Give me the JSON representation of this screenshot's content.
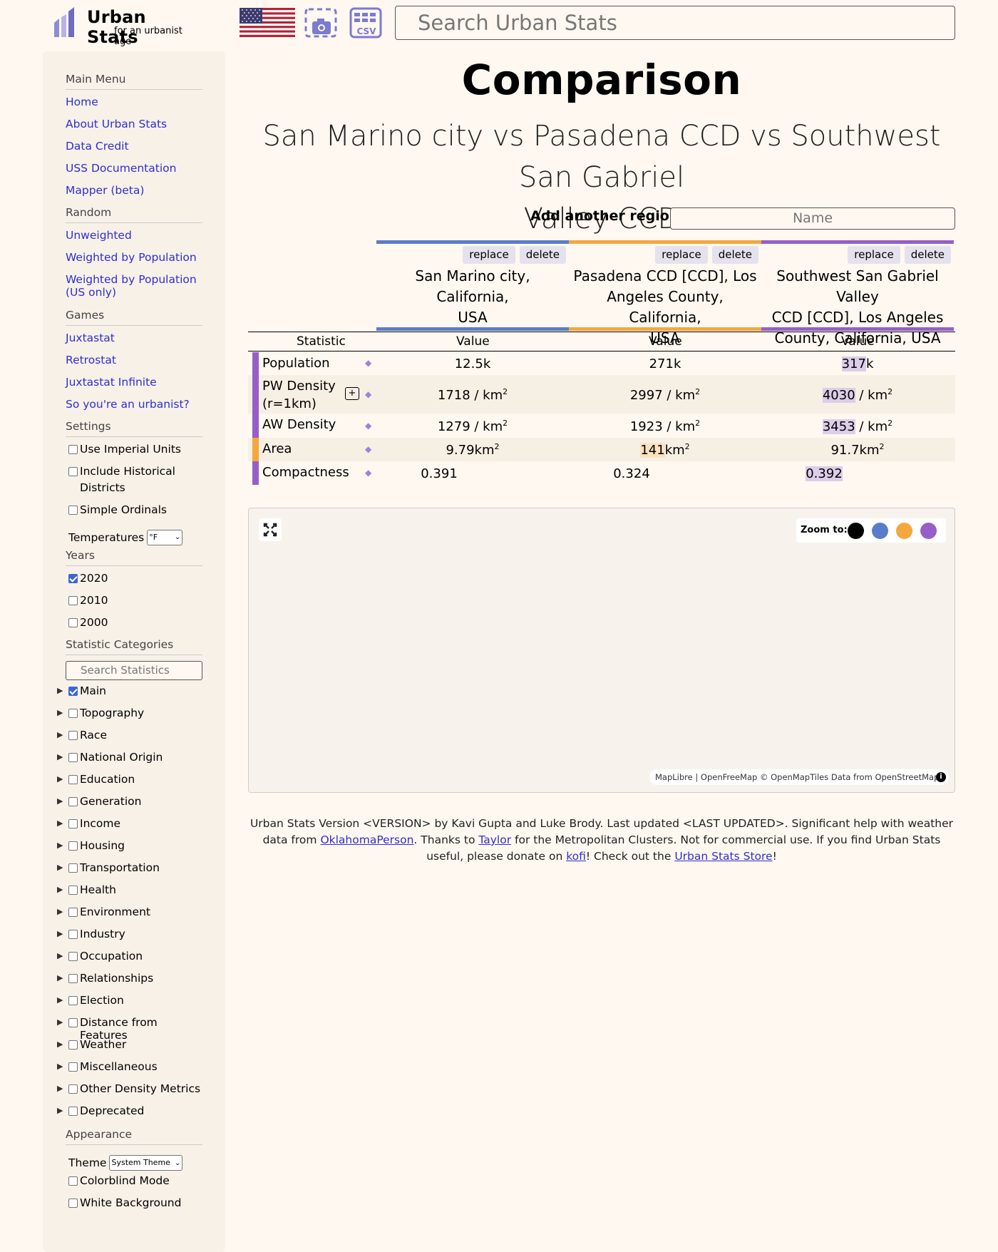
{
  "header": {
    "logo_title": "Urban Stats",
    "logo_subtitle": "for an urbanist age",
    "flag_icon": "us-flag-icon",
    "camera_icon": "screenshot-icon",
    "csv_icon": "csv-icon",
    "search_placeholder": "Search Urban Stats"
  },
  "sidebar": {
    "main_menu": {
      "heading": "Main Menu",
      "links": [
        "Home",
        "About Urban Stats",
        "Data Credit",
        "USS Documentation",
        "Mapper (beta)"
      ]
    },
    "random": {
      "heading": "Random",
      "links": [
        "Unweighted",
        "Weighted by Population",
        "Weighted by Population (US only)"
      ]
    },
    "games": {
      "heading": "Games",
      "links": [
        "Juxtastat",
        "Retrostat",
        "Juxtastat Infinite",
        "So you're an urbanist?"
      ]
    },
    "settings": {
      "heading": "Settings",
      "options": [
        {
          "label": "Use Imperial Units",
          "checked": false
        },
        {
          "label": "Include Historical Districts",
          "checked": false
        },
        {
          "label": "Simple Ordinals",
          "checked": false
        }
      ],
      "temperatures_label": "Temperatures",
      "temperatures_value": "°F"
    },
    "years": {
      "heading": "Years",
      "options": [
        {
          "label": "2020",
          "checked": true
        },
        {
          "label": "2010",
          "checked": false
        },
        {
          "label": "2000",
          "checked": false
        }
      ]
    },
    "statistic_categories": {
      "heading": "Statistic Categories",
      "search_placeholder": "Search Statistics",
      "items": [
        {
          "label": "Main",
          "checked": true
        },
        {
          "label": "Topography",
          "checked": false
        },
        {
          "label": "Race",
          "checked": false
        },
        {
          "label": "National Origin",
          "checked": false
        },
        {
          "label": "Education",
          "checked": false
        },
        {
          "label": "Generation",
          "checked": false
        },
        {
          "label": "Income",
          "checked": false
        },
        {
          "label": "Housing",
          "checked": false
        },
        {
          "label": "Transportation",
          "checked": false
        },
        {
          "label": "Health",
          "checked": false
        },
        {
          "label": "Environment",
          "checked": false
        },
        {
          "label": "Industry",
          "checked": false
        },
        {
          "label": "Occupation",
          "checked": false
        },
        {
          "label": "Relationships",
          "checked": false
        },
        {
          "label": "Election",
          "checked": false
        },
        {
          "label": "Distance from Features",
          "checked": false
        },
        {
          "label": "Weather",
          "checked": false
        },
        {
          "label": "Miscellaneous",
          "checked": false
        },
        {
          "label": "Other Density Metrics",
          "checked": false
        },
        {
          "label": "Deprecated",
          "checked": false
        }
      ]
    },
    "appearance": {
      "heading": "Appearance",
      "theme_label": "Theme",
      "theme_value": "System Theme",
      "options": [
        {
          "label": "Colorblind Mode",
          "checked": false
        },
        {
          "label": "White Background",
          "checked": false
        }
      ]
    }
  },
  "main": {
    "title": "Comparison",
    "subtitle_line1": "San Marino city vs Pasadena CCD vs Southwest San Gabriel",
    "subtitle_line2": "Valley CCD",
    "add_region_label": "Add another region:",
    "add_region_placeholder": "Name",
    "replace_label": "replace",
    "delete_label": "delete",
    "regions": [
      {
        "name": "San Marino city, California, USA",
        "color": "#5a7dc9"
      },
      {
        "name": "Pasadena CCD [CCD], Los Angeles County, California, USA",
        "color": "#f4a73f"
      },
      {
        "name": "Southwest San Gabriel Valley CCD [CCD], Los Angeles County, California, USA",
        "color": "#975ec8"
      }
    ],
    "table": {
      "headers": {
        "statistic": "Statistic",
        "value": "Value"
      },
      "rows": [
        {
          "statistic": "Population",
          "stripe": "#975ec8",
          "values": [
            {
              "num": "12.5",
              "unit": "k",
              "sup": ""
            },
            {
              "num": "271",
              "unit": "k",
              "sup": ""
            },
            {
              "num": "317",
              "unit": "k",
              "sup": ""
            }
          ]
        },
        {
          "statistic_l1": "PW Density",
          "statistic_l2": "(r=1km)",
          "stripe": "#975ec8",
          "values": [
            {
              "num": "1718",
              "unit": " / km",
              "sup": "2"
            },
            {
              "num": "2997",
              "unit": " / km",
              "sup": "2"
            },
            {
              "num": "4030",
              "unit": " / km",
              "sup": "2"
            }
          ]
        },
        {
          "statistic": "AW Density",
          "stripe": "#975ec8",
          "values": [
            {
              "num": "1279",
              "unit": " / km",
              "sup": "2"
            },
            {
              "num": "1923",
              "unit": " / km",
              "sup": "2"
            },
            {
              "num": "3453",
              "unit": " / km",
              "sup": "2"
            }
          ]
        },
        {
          "statistic": "Area",
          "stripe": "#f4a73f",
          "values": [
            {
              "num": "9.79",
              "unit": "km",
              "sup": "2"
            },
            {
              "num": "141",
              "unit": "km",
              "sup": "2"
            },
            {
              "num": "91.7",
              "unit": "km",
              "sup": "2"
            }
          ]
        },
        {
          "statistic": "Compactness",
          "stripe": "#975ec8",
          "values": [
            {
              "num": "0.391",
              "unit": "",
              "sup": ""
            },
            {
              "num": "0.324",
              "unit": "",
              "sup": ""
            },
            {
              "num": "0.392",
              "unit": "",
              "sup": ""
            }
          ]
        }
      ]
    },
    "map": {
      "expand_icon": "expand-icon",
      "zoom_label": "Zoom to:",
      "zoom_colors": [
        "#000000",
        "#5a7dc9",
        "#f4a73f",
        "#975ec8"
      ],
      "attribution_maplibre": "MapLibre",
      "attribution_sep": " | ",
      "attribution_ofm": "OpenFreeMap",
      "attribution_omt": "© OpenMapTiles",
      "attribution_data": " Data from ",
      "attribution_osm": "OpenStreetMap"
    },
    "footer": {
      "text1": "Urban Stats Version <VERSION> by Kavi Gupta and Luke Brody. Last updated <LAST UPDATED>. Significant help with weather data from ",
      "link1": "OklahomaPerson",
      "text2": ". Thanks to ",
      "link2": "Taylor",
      "text3": " for the Metropolitan Clusters. Not for commercial use. If you find Urban Stats useful, please donate on ",
      "link3": "kofi",
      "text4": "! Check out the ",
      "link4": "Urban Stats Store",
      "text5": "!"
    }
  }
}
